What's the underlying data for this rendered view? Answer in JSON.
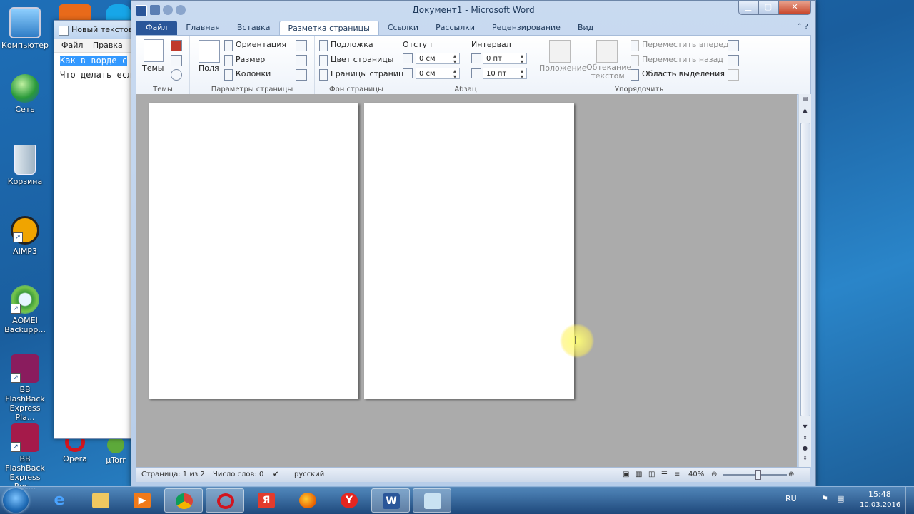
{
  "desktop": {
    "icons": [
      {
        "label": "Компьютер"
      },
      {
        "label": "Сеть"
      },
      {
        "label": "Корзина"
      },
      {
        "label": "AIMP3"
      },
      {
        "label": "AOMEI Backupp..."
      },
      {
        "label": "BB FlashBack Express Pla..."
      },
      {
        "label": "BB FlashBack Express Rec..."
      },
      {
        "label": "Opera"
      },
      {
        "label": "μTorr"
      }
    ]
  },
  "notepad": {
    "title": "Новый текстовы",
    "menu": [
      "Файл",
      "Правка"
    ],
    "line1": "Как в ворде с",
    "line2": "Что делать есл"
  },
  "word": {
    "caption": "Документ1 - Microsoft Word",
    "tabs": [
      "Файл",
      "Главная",
      "Вставка",
      "Разметка страницы",
      "Ссылки",
      "Рассылки",
      "Рецензирование",
      "Вид"
    ],
    "ribbon": {
      "themes": {
        "button": "Темы",
        "group": "Темы"
      },
      "page_setup": {
        "margins": "Поля",
        "orientation": "Ориентация",
        "size": "Размер",
        "columns": "Колонки",
        "group": "Параметры страницы"
      },
      "page_background": {
        "watermark": "Подложка",
        "page_color": "Цвет страницы",
        "page_borders": "Границы страниц",
        "group": "Фон страницы"
      },
      "paragraph": {
        "indent_label": "Отступ",
        "spacing_label": "Интервал",
        "indent_left": "0 см",
        "indent_right": "0 см",
        "spacing_before": "0 пт",
        "spacing_after": "10 пт",
        "group": "Абзац"
      },
      "arrange": {
        "position": "Положение",
        "wrap_text": "Обтекание текстом",
        "bring_forward": "Переместить вперед",
        "send_backward": "Переместить назад",
        "selection_pane": "Область выделения",
        "group": "Упорядочить"
      }
    },
    "status": {
      "page": "Страница: 1 из 2",
      "words": "Число слов: 0",
      "language": "русский",
      "zoom": "40%",
      "zoom_fraction": 0.55
    }
  },
  "taskbar": {
    "lang": "RU",
    "time": "15:48",
    "date": "10.03.2016"
  }
}
